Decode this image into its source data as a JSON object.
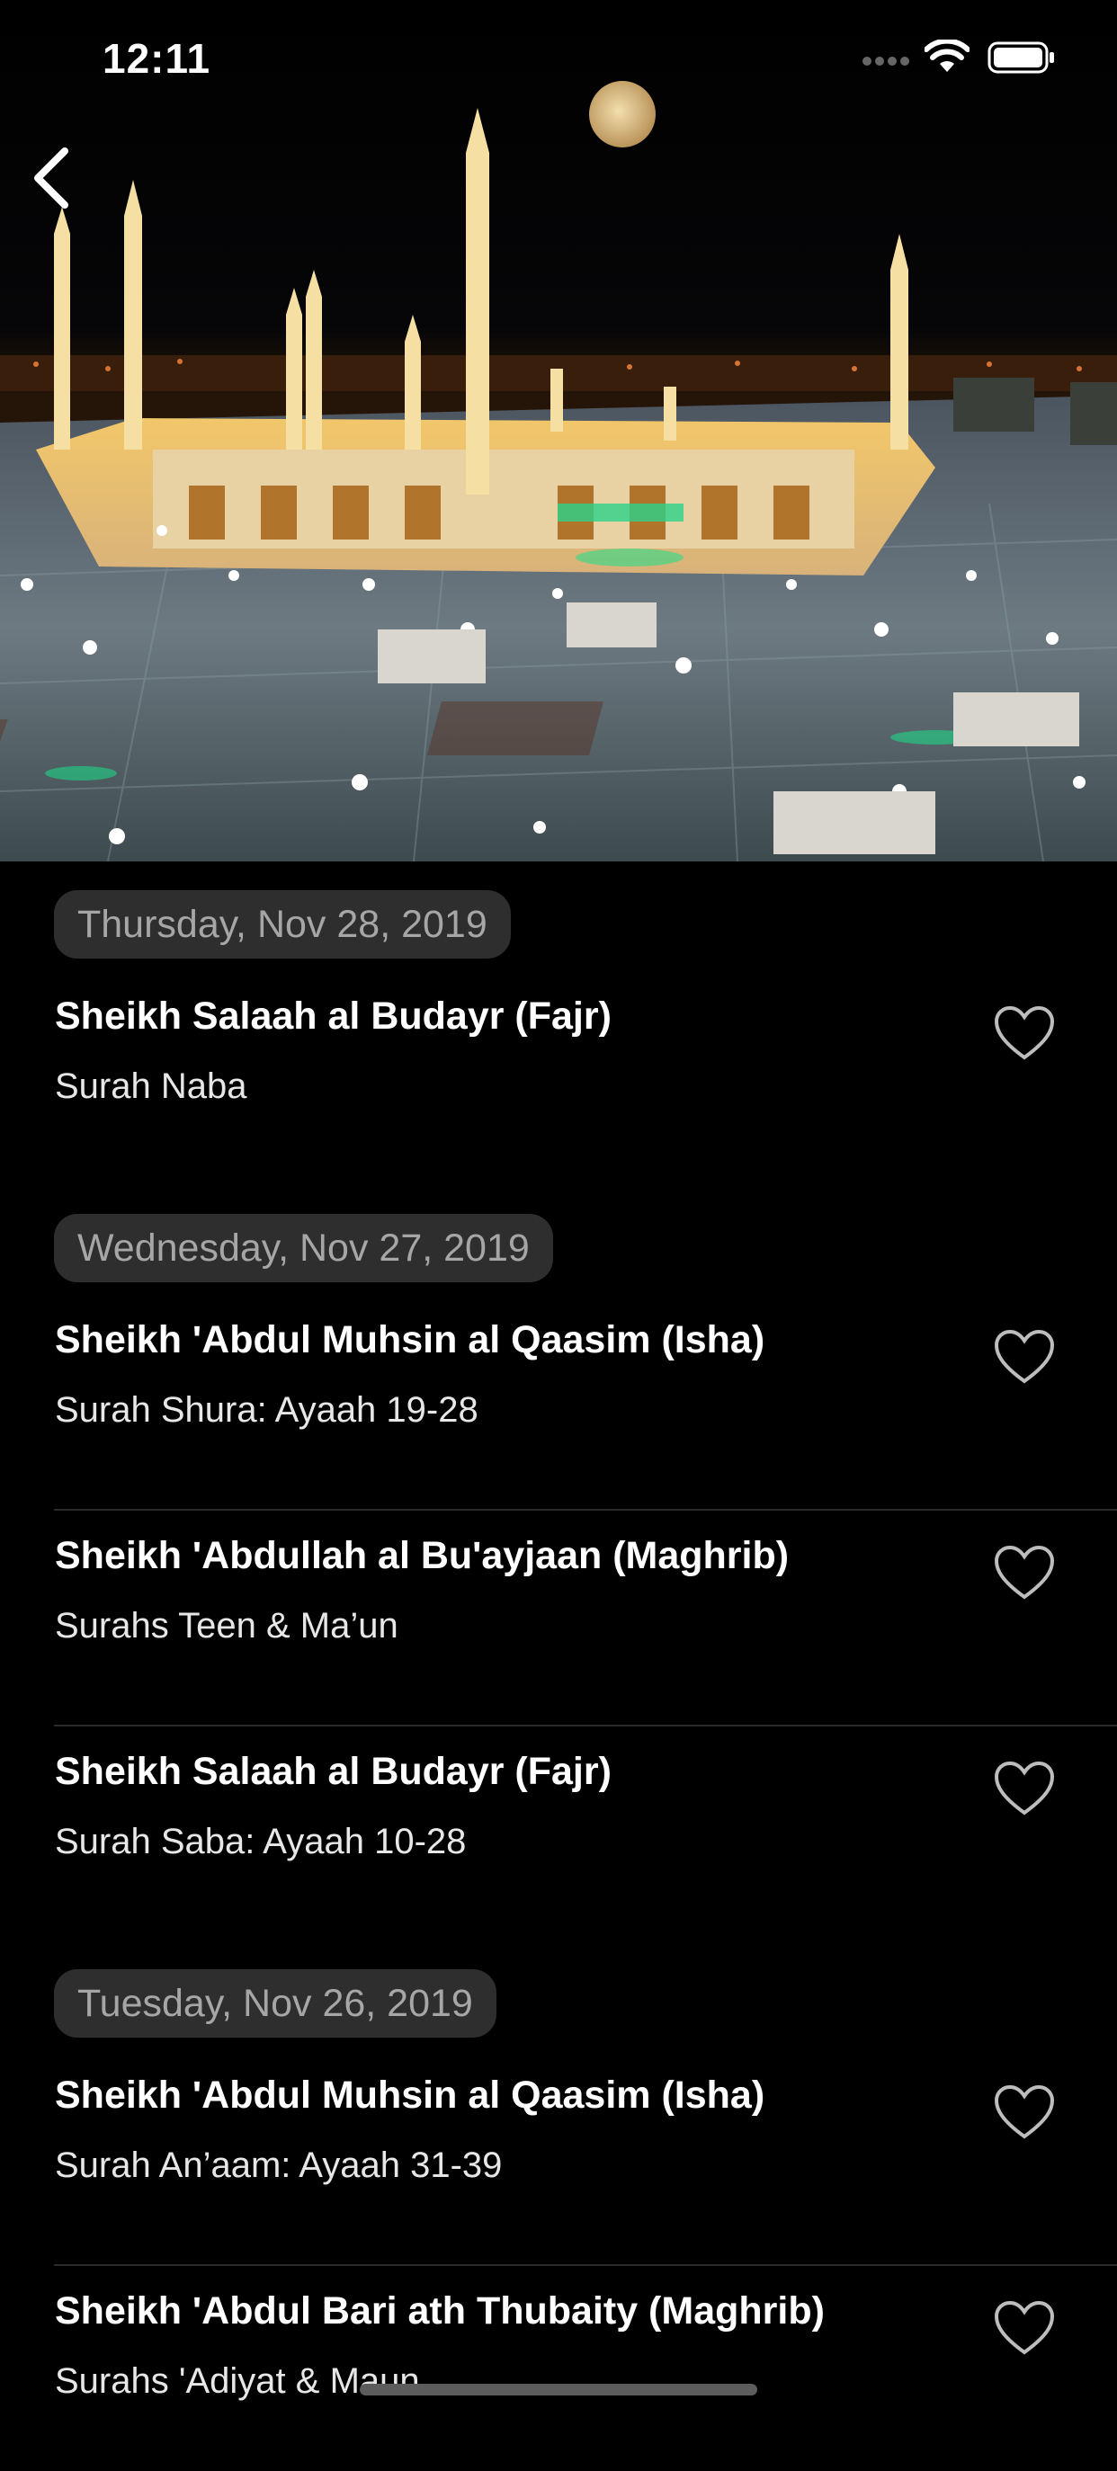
{
  "status_bar": {
    "time": "12:11"
  },
  "header": {
    "back_icon": "chevron-left-icon",
    "hero_image": "mosque-at-night-photo"
  },
  "sections": [
    {
      "date": "Thursday, Nov 28, 2019",
      "items": [
        {
          "title": "Sheikh Salaah al Budayr (Fajr)",
          "subtitle": "Surah Naba"
        }
      ]
    },
    {
      "date": "Wednesday, Nov 27, 2019",
      "items": [
        {
          "title": "Sheikh 'Abdul Muhsin al Qaasim (Isha)",
          "subtitle": "Surah Shura: Ayaah 19-28"
        },
        {
          "title": "Sheikh 'Abdullah al Bu'ayjaan (Maghrib)",
          "subtitle": "Surahs Teen & Ma’un"
        },
        {
          "title": "Sheikh Salaah al Budayr (Fajr)",
          "subtitle": "Surah Saba: Ayaah 10-28"
        }
      ]
    },
    {
      "date": "Tuesday, Nov 26, 2019",
      "items": [
        {
          "title": "Sheikh 'Abdul Muhsin al Qaasim (Isha)",
          "subtitle": "Surah An’aam: Ayaah 31-39"
        },
        {
          "title": "Sheikh 'Abdul Bari ath Thubaity (Maghrib)",
          "subtitle": "Surahs 'Adiyat & Maun"
        }
      ]
    }
  ],
  "colors": {
    "background": "#000000",
    "pill": "#2e2e2e",
    "pill_text": "#a6a6a6",
    "heart": "#bdbdbd"
  }
}
